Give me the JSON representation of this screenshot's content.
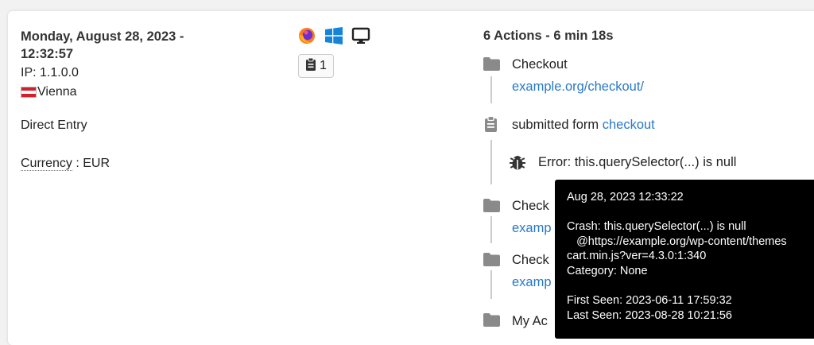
{
  "visit": {
    "date_line1": "Monday, August 28, 2023 -",
    "date_line2": "12:32:57",
    "ip": "IP: 1.1.0.0",
    "city": "Vienna",
    "referrer": "Direct Entry",
    "currency_label": "Currency",
    "currency_value": " : EUR"
  },
  "device": {
    "browser_icon": "firefox-icon",
    "os_icon": "windows-icon",
    "device_icon": "desktop-icon",
    "forms_count": "1"
  },
  "actions": {
    "summary": "6 Actions - 6 min 18s",
    "items": [
      {
        "icon": "folder-icon",
        "title": "Checkout",
        "url": "example.org/checkout/"
      },
      {
        "icon": "clipboard-icon",
        "prefix": "submitted form ",
        "form": "checkout"
      },
      {
        "icon": "bug-icon",
        "error": "Error: this.querySelector(...) is null"
      },
      {
        "icon": "folder-icon",
        "title": "Check",
        "url": "examp"
      },
      {
        "icon": "folder-icon",
        "title": "Check",
        "url": "examp"
      },
      {
        "icon": "folder-icon",
        "title": "My Ac"
      }
    ]
  },
  "tooltip": {
    "timestamp": "Aug 28, 2023 12:33:22",
    "crash": "Crash: this.querySelector(...) is null",
    "stack1": "   @https://example.org/wp-content/themes",
    "stack2": "cart.min.js?ver=4.3.0:1:340",
    "category": "Category: None",
    "first_seen": "First Seen: 2023-06-11 17:59:32",
    "last_seen": "Last Seen: 2023-08-28 10:21:56"
  },
  "colors": {
    "link": "#2878c8",
    "icon_gray": "#8a8a8a",
    "tooltip_bg": "#000000",
    "flag_red": "#d0202c"
  }
}
